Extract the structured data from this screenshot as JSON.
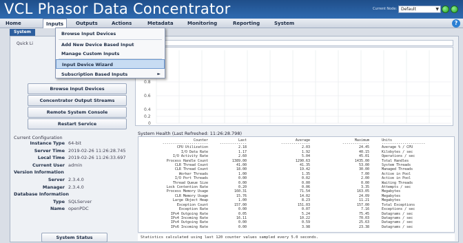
{
  "app": {
    "title": "VCL Phasor Data Concentrator"
  },
  "node": {
    "label": "Current Node:",
    "value": "Default"
  },
  "menu": [
    "Home",
    "Inputs",
    "Outputs",
    "Actions",
    "Metadata",
    "Monitoring",
    "Reporting",
    "System"
  ],
  "tab": "System",
  "quick_links_label": "Quick Li",
  "dropdown": [
    {
      "label": "Browse Input Devices"
    },
    {
      "label": "Add New Device Based Input"
    },
    {
      "label": "Manage Custom Inputs"
    },
    {
      "label": "Input Device Wizard"
    },
    {
      "label": "Subscription Based Inputs"
    }
  ],
  "quick_buttons": [
    "Browse Input Devices",
    "Concentrator Output Streams",
    "Remote System Console",
    "Restart Service"
  ],
  "chart": {
    "y_ticks": [
      "0.8",
      "0.6",
      "0.4",
      "0.2",
      "0"
    ]
  },
  "config": {
    "title": "Current Configuration",
    "rows": [
      {
        "k": "Instance Type",
        "v": "64-bit"
      },
      {
        "k": "Server Time",
        "v": "2019-02-26 11:26:28.745"
      },
      {
        "k": "Local Time",
        "v": "2019-02-26 11:26:33.697"
      },
      {
        "k": "Current User",
        "v": "admin"
      },
      {
        "k": "Version Information",
        "v": "",
        "hdr": true
      },
      {
        "k": "Server",
        "v": "2.3.4.0"
      },
      {
        "k": "Manager",
        "v": "2.3.4.0"
      },
      {
        "k": "Database Information",
        "v": "",
        "hdr": true
      },
      {
        "k": "Type",
        "v": "SQLServer"
      },
      {
        "k": "Name",
        "v": "openPDC"
      }
    ]
  },
  "status_button": "System Status",
  "health": {
    "title": "System Health (Last Refreshed: 11:26:28.798)",
    "headers": [
      "Counter",
      "Last",
      "Average",
      "Maximum",
      "Units"
    ],
    "separators": [
      "----------------------",
      "-------------",
      "--------------",
      "-------------",
      "---------------------"
    ],
    "rows": [
      [
        "CPU Utilization",
        "2.18",
        "2.03",
        "24.45",
        "Average % / CPU"
      ],
      [
        "I/O Data Rate",
        "1.17",
        "1.92",
        "40.15",
        "Kilobytes / sec"
      ],
      [
        "I/O Activity Rate",
        "2.60",
        "5.04",
        "45.01",
        "Operations / sec"
      ],
      [
        "Process Handle Count",
        "1389.00",
        "1290.63",
        "1435.00",
        "Total Handles"
      ],
      [
        "CLR Thread Count",
        "41.00",
        "41.35",
        "53.00",
        "System Threads"
      ],
      [
        "CLR Thread Count",
        "18.00",
        "19.42",
        "30.00",
        "Managed Threads"
      ],
      [
        "Worker Threads",
        "1.00",
        "1.35",
        "7.00",
        "Active in Pool"
      ],
      [
        "I/O Port Threads",
        "0.00",
        "0.02",
        "2.00",
        "Active in Pool"
      ],
      [
        "Thread Queue Size",
        "0.00",
        "0.00",
        "0.00",
        "Waiting Threads"
      ],
      [
        "Lock Contention Rate",
        "0.20",
        "0.06",
        "3.35",
        "Attempts / sec"
      ],
      [
        "Process Memory Usage",
        "160.31",
        "71.54",
        "163.05",
        "Megabytes"
      ],
      [
        "CLR Memory Usage",
        "15.76",
        "14.02",
        "24.09",
        "Megabytes"
      ],
      [
        "Large Object Heap",
        "1.00",
        "8.23",
        "11.21",
        "Megabytes"
      ],
      [
        "Exception Count",
        "157.00",
        "151.03",
        "157.00",
        "Total Exceptions"
      ],
      [
        "Exception Rate",
        "0.00",
        "0.07",
        "7.16",
        "Exceptions / sec"
      ],
      [
        "IPv4 Outgoing Rate",
        "0.05",
        "5.24",
        "75.45",
        "Datagrams / sec"
      ],
      [
        "IPv4 Incoming Rate",
        "16.11",
        "10.22",
        "70.03",
        "Datagrams / sec"
      ],
      [
        "IPv4 Outgoing Rate",
        "0.00",
        "0.59",
        "25.63",
        "Datagrams / sec"
      ],
      [
        "IPv6 Incoming Rate",
        "0.00",
        "3.98",
        "23.38",
        "Datagrams / sec"
      ]
    ],
    "footer": "Statistics calculated using last 120 counter values sampled every 5.0 seconds."
  }
}
